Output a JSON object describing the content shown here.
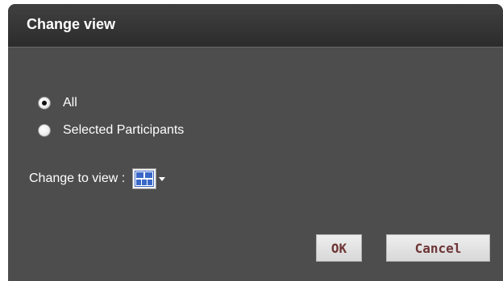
{
  "dialog": {
    "title": "Change view",
    "radio_options": [
      {
        "label": "All",
        "checked": true
      },
      {
        "label": "Selected Participants",
        "checked": false
      }
    ],
    "change_to_view_label": "Change to view :",
    "view_icon": "grid-layout-icon",
    "ok_label": "OK",
    "cancel_label": "Cancel"
  },
  "colors": {
    "dialog_bg": "#4c4c4c",
    "title_bg": "#2c2c2c",
    "button_text": "#6e3535",
    "layout_icon_blue": "#3a68c8"
  }
}
